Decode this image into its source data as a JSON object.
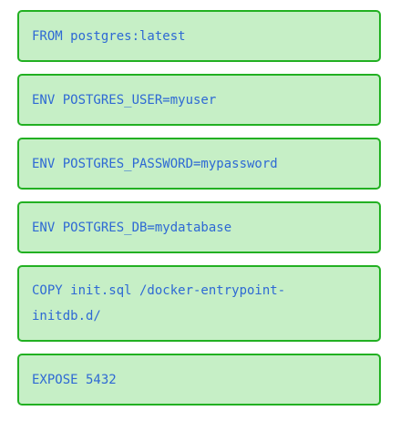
{
  "colors": {
    "block_fill": "#c6efc6",
    "block_border": "#22b022",
    "code_text": "#2e69d4"
  },
  "instructions": [
    {
      "text": "FROM postgres:latest"
    },
    {
      "text": "ENV POSTGRES_USER=myuser"
    },
    {
      "text": "ENV POSTGRES_PASSWORD=mypassword"
    },
    {
      "text": "ENV POSTGRES_DB=mydatabase"
    },
    {
      "line1": "COPY init.sql /docker-entrypoint-",
      "line2": "initdb.d/"
    },
    {
      "text": "EXPOSE 5432"
    }
  ]
}
